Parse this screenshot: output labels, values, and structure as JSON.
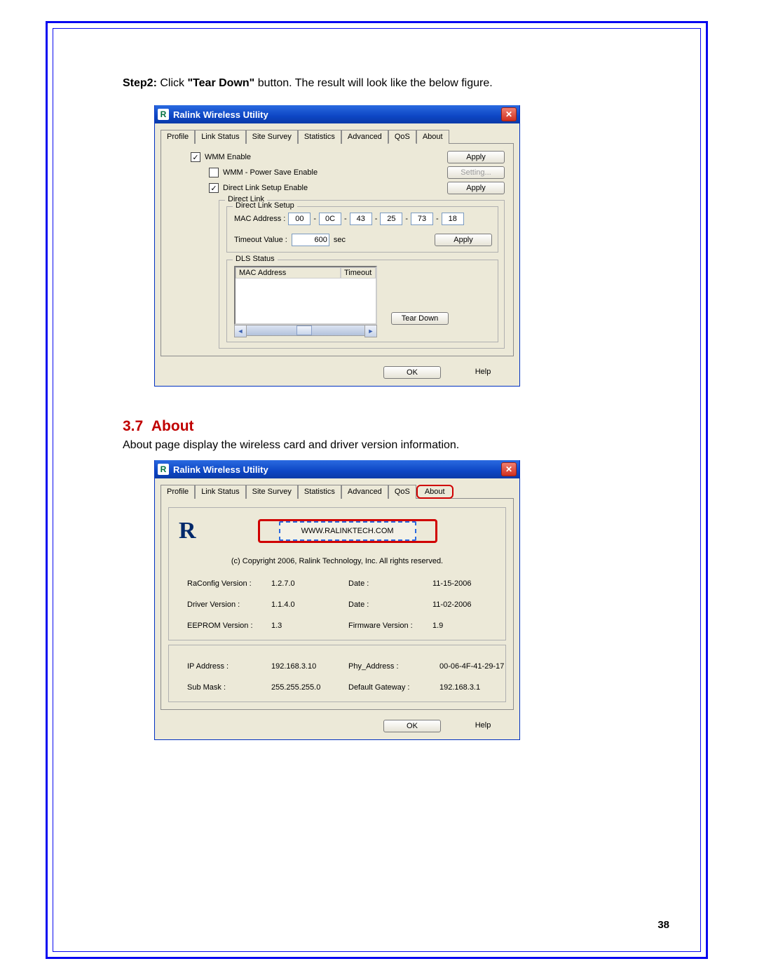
{
  "step_prefix": "Step2:",
  "step_verb": " Click ",
  "step_bold": "\"Tear Down\"",
  "step_rest": " button. The result will look like the below figure.",
  "window_title": "Ralink Wireless Utility",
  "tabs": {
    "profile": "Profile",
    "link": "Link Status",
    "site": "Site Survey",
    "stats": "Statistics",
    "adv": "Advanced",
    "qos": "QoS",
    "about": "About"
  },
  "qos": {
    "wmm_enable": "WMM Enable",
    "wmm_ps": "WMM - Power Save Enable",
    "dl_enable": "Direct Link Setup Enable",
    "apply": "Apply",
    "setting": "Setting...",
    "direct_link": "Direct Link",
    "direct_link_setup": "Direct Link Setup",
    "mac_label": "MAC Address :",
    "mac": [
      "00",
      "0C",
      "43",
      "25",
      "73",
      "18"
    ],
    "timeout_label": "Timeout Value :",
    "timeout_val": "600",
    "sec": "sec",
    "dls_status": "DLS Status",
    "col_mac": "MAC Address",
    "col_timeout": "Timeout",
    "tear_down": "Tear Down"
  },
  "ok": "OK",
  "help": "Help",
  "section_num": "3.7",
  "section_title": "About",
  "about_desc": "About page display the wireless card and driver version information.",
  "about": {
    "url": "WWW.RALINKTECH.COM",
    "copyright": "(c) Copyright 2006, Ralink Technology, Inc.  All rights reserved.",
    "raconfig_l": "RaConfig Version :",
    "raconfig_v": "1.2.7.0",
    "date_l": "Date :",
    "raconfig_d": "11-15-2006",
    "driver_l": "Driver Version :",
    "driver_v": "1.1.4.0",
    "driver_d": "11-02-2006",
    "eeprom_l": "EEPROM Version :",
    "eeprom_v": "1.3",
    "fw_l": "Firmware Version :",
    "fw_v": "1.9",
    "ip_l": "IP Address :",
    "ip_v": "192.168.3.10",
    "phy_l": "Phy_Address :",
    "phy_v": "00-06-4F-41-29-17",
    "mask_l": "Sub Mask :",
    "mask_v": "255.255.255.0",
    "gw_l": "Default Gateway :",
    "gw_v": "192.168.3.1"
  },
  "page_number": "38"
}
